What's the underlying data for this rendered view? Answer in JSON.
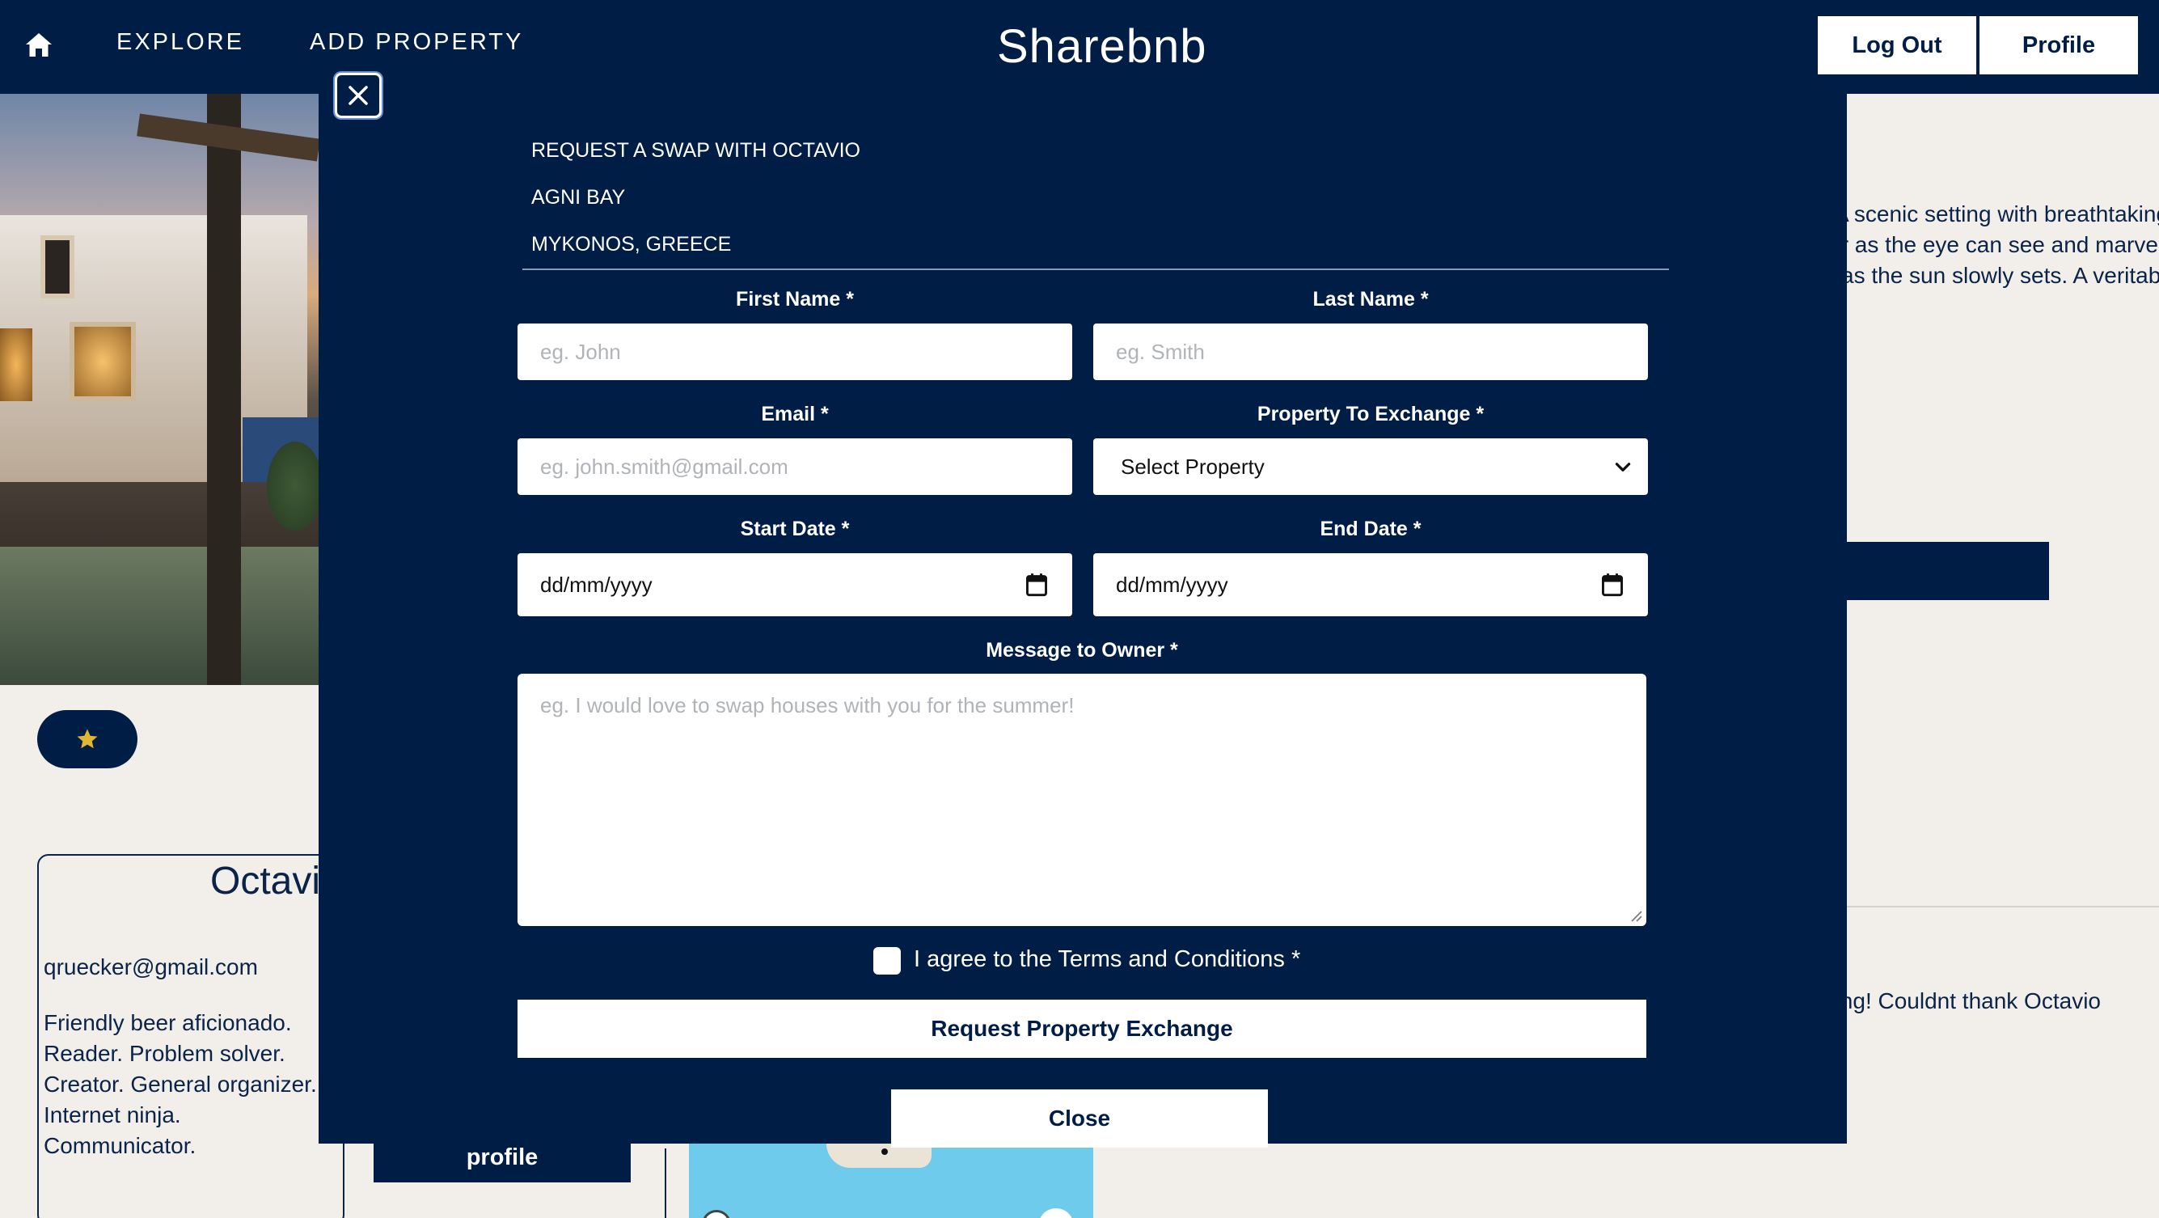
{
  "nav": {
    "home_icon": "home-icon",
    "explore": "EXPLORE",
    "add_property": "ADD PROPERTY",
    "brand": "Sharebnb",
    "logout": "Log Out",
    "profile": "Profile"
  },
  "background": {
    "owner_name": "Octavio",
    "owner_email": "qruecker@gmail.com",
    "owner_bio": "Friendly beer aficionado.\nReader. Problem solver.\nCreator. General organizer.\nInternet ninja. Communicator.",
    "profile_button": "profile",
    "description_lines": [
      "A scenic setting with breathtaking se",
      "as far as the eye can see and marvel at na",
      "as the sun slowly sets. A veritable kaleidos"
    ],
    "review_text": "Amazing! Couldnt thank Octavio",
    "star_icon": "star-icon"
  },
  "modal": {
    "close_icon": "close-icon",
    "heading": "REQUEST A SWAP WITH OCTAVIO",
    "property_name": "AGNI BAY",
    "location": "MYKONOS, GREECE",
    "first_name_label": "First Name *",
    "first_name_placeholder": "eg. John",
    "last_name_label": "Last Name *",
    "last_name_placeholder": "eg. Smith",
    "email_label": "Email *",
    "email_placeholder": "eg. john.smith@gmail.com",
    "property_label": "Property To Exchange *",
    "property_value": "Select Property",
    "start_label": "Start Date *",
    "start_value": "dd/mm/yyyy",
    "end_label": "End Date *",
    "end_value": "dd/mm/yyyy",
    "message_label": "Message to Owner *",
    "message_placeholder": "eg. I would love to swap houses with you for the summer!",
    "terms_label": "I agree to the Terms and Conditions *",
    "terms_checked": false,
    "submit": "Request Property Exchange",
    "close": "Close"
  }
}
